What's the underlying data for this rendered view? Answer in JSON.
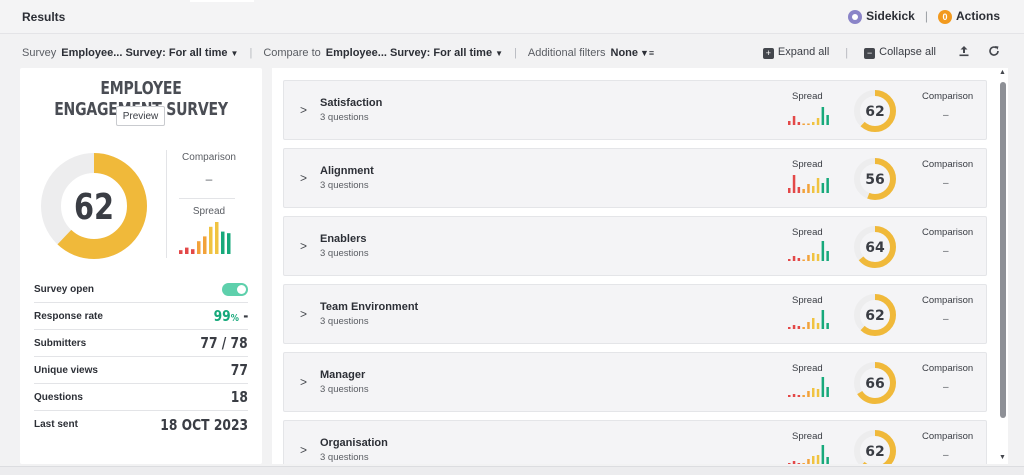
{
  "header": {
    "title": "Results",
    "sidekick": "Sidekick",
    "actions_count": "0",
    "actions": "Actions",
    "sep": "|"
  },
  "filters": {
    "survey_label": "Survey",
    "survey_value": "Employee... Survey: For all time",
    "compare_label": "Compare to",
    "compare_value": "Employee... Survey: For all time",
    "additional_label": "Additional filters",
    "additional_value": "None",
    "expand_all": "Expand all",
    "collapse_all": "Collapse all",
    "sep": "|"
  },
  "survey": {
    "title": "EMPLOYEE ENGAGEMENT SURVEY",
    "preview": "Preview",
    "score": "62",
    "comparison_label": "Comparison",
    "comparison_value": "–",
    "spread_label": "Spread",
    "spread_bars": [
      {
        "h": 0.12,
        "c": "#e34848"
      },
      {
        "h": 0.2,
        "c": "#e34848"
      },
      {
        "h": 0.15,
        "c": "#e34848"
      },
      {
        "h": 0.4,
        "c": "#f2a23a"
      },
      {
        "h": 0.55,
        "c": "#f2a23a"
      },
      {
        "h": 0.85,
        "c": "#f0c341"
      },
      {
        "h": 1.0,
        "c": "#f0c341"
      },
      {
        "h": 0.7,
        "c": "#17a97b"
      },
      {
        "h": 0.65,
        "c": "#17a97b"
      }
    ],
    "stats": [
      {
        "label": "Survey open",
        "value": "",
        "type": "toggle"
      },
      {
        "label": "Response rate",
        "value": "99",
        "unit": "%",
        "suffix": "-",
        "type": "pct"
      },
      {
        "label": "Submitters",
        "value": "77 / 78",
        "type": "text"
      },
      {
        "label": "Unique views",
        "value": "77",
        "type": "text"
      },
      {
        "label": "Questions",
        "value": "18",
        "type": "text"
      },
      {
        "label": "Last sent",
        "value": "18 OCT 2023",
        "type": "text"
      }
    ]
  },
  "categories": [
    {
      "name": "Satisfaction",
      "sub": "3 questions",
      "score": "62",
      "spread": [
        0.2,
        0.45,
        0.15,
        0.05,
        0.05,
        0.15,
        0.35,
        0.9,
        0.5
      ]
    },
    {
      "name": "Alignment",
      "sub": "3 questions",
      "score": "56",
      "spread": [
        0.25,
        0.9,
        0.3,
        0.2,
        0.45,
        0.35,
        0.75,
        0.5,
        0.75
      ]
    },
    {
      "name": "Enablers",
      "sub": "3 questions",
      "score": "64",
      "spread": [
        0.1,
        0.25,
        0.15,
        0.05,
        0.3,
        0.4,
        0.35,
        1.0,
        0.5
      ]
    },
    {
      "name": "Team Environment",
      "sub": "3 questions",
      "score": "62",
      "spread": [
        0.1,
        0.2,
        0.15,
        0.1,
        0.35,
        0.55,
        0.3,
        0.95,
        0.3
      ]
    },
    {
      "name": "Manager",
      "sub": "3 questions",
      "score": "66",
      "spread": [
        0.1,
        0.15,
        0.1,
        0.1,
        0.3,
        0.45,
        0.4,
        1.0,
        0.5
      ]
    },
    {
      "name": "Organisation",
      "sub": "3 questions",
      "score": "62",
      "spread": [
        0.1,
        0.2,
        0.1,
        0.1,
        0.3,
        0.45,
        0.5,
        1.0,
        0.4
      ]
    }
  ],
  "card_labels": {
    "spread": "Spread",
    "comparison": "Comparison",
    "comparison_value": "–"
  },
  "colors": {
    "accent": "#f0b93a",
    "track": "#ededee",
    "green": "#17a97b",
    "red": "#e34848"
  }
}
